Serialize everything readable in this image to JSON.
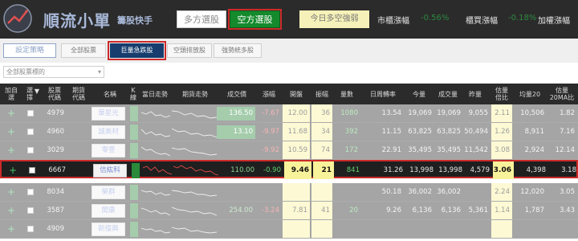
{
  "header": {
    "brand_name": "順流小單",
    "brand_sub": "籌股快手",
    "tabs": [
      "多方選股",
      "空方選股"
    ],
    "daily_strength": "今日多空強弱",
    "indices": [
      {
        "label": "市櫃漲幅",
        "value": "-0.56%"
      },
      {
        "label": "櫃買漲幅",
        "value": "-0.18%"
      },
      {
        "label": "加權漲幅",
        "value": ""
      }
    ],
    "accent_colors": {
      "selected_tab": "#148a2c",
      "highlight_border": "#cc2a2a",
      "selected_chip": "#163d6e",
      "price_cell": "#f8f29a"
    }
  },
  "filters": {
    "strategy": "設定策略",
    "chips": [
      "全部股票",
      "巨量急跌股",
      "空頭排放股",
      "強勢統多股"
    ],
    "selected_chip": "巨量急跌股",
    "select_value": "全部股票標的"
  },
  "table": {
    "columns": {
      "add": [
        "加自",
        "選"
      ],
      "sel": [
        "選",
        "擇"
      ],
      "code": [
        "股票",
        "代碼"
      ],
      "sub": [
        "期貨",
        "代碼"
      ],
      "name": [
        "名稱"
      ],
      "k": [
        "K",
        "線"
      ],
      "trend": [
        "當日走勢"
      ],
      "trend2": [
        "期貨走勢"
      ],
      "close": [
        "成交價"
      ],
      "change": [
        "漲幅"
      ],
      "open": [
        "開盤"
      ],
      "high": [
        "振幅"
      ],
      "vol": [
        "量數"
      ],
      "ratio": [
        "日周轉率"
      ],
      "today_vol": [
        "今量"
      ],
      "amount": [
        "成交量"
      ],
      "yest": [
        "昨量"
      ],
      "est": [
        "估量",
        "倍比"
      ],
      "avg20": [
        "均量20"
      ],
      "estavg": [
        "估量",
        "20MA比"
      ]
    },
    "sort_arrow": "▼",
    "rows": [
      {
        "add": "+",
        "code": "4979",
        "name": "華星光",
        "close": "136.50",
        "change": "-7.67",
        "open": "12.00",
        "high": "36",
        "vol": "1080",
        "ratio": "13.54",
        "today_vol": "19,069",
        "amount": "19,069",
        "yest": "9,055",
        "est": "2.11",
        "avg20": "10,506",
        "estavg": "1.82",
        "close_style": "green"
      },
      {
        "add": "+",
        "code": "4960",
        "name": "誠美材",
        "close": "13.10",
        "change": "-9.97",
        "open": "11.68",
        "high": "34",
        "vol": "392",
        "ratio": "11.15",
        "today_vol": "63,825",
        "amount": "63,825",
        "yest": "50,494",
        "est": "1.26",
        "avg20": "8,911",
        "estavg": "7.16",
        "close_style": "green"
      },
      {
        "add": "+",
        "code": "3029",
        "name": "零壹",
        "close": "",
        "change": "-9.92",
        "open": "10.59",
        "high": "74",
        "vol": "172",
        "ratio": "22.91",
        "today_vol": "35,495",
        "amount": "35,495",
        "yest": "11,542",
        "est": "3.08",
        "avg20": "2,924",
        "estavg": "12.14",
        "close_style": "none"
      },
      {
        "add": "+",
        "code": "6667",
        "name": "信紘科",
        "close": "110.00",
        "change": "-0.90",
        "open": "9.46",
        "high": "21",
        "vol": "841",
        "ratio": "31.26",
        "today_vol": "13,998",
        "amount": "13,998",
        "yest": "4,579",
        "est": "3.06",
        "avg20": "4,398",
        "estavg": "3.18",
        "close_style": "plain"
      },
      {
        "add": "+",
        "code": "8034",
        "name": "榮群",
        "close": "",
        "change": "",
        "open": "",
        "high": "",
        "vol": "",
        "ratio": "50.18",
        "today_vol": "36,002",
        "amount": "36,002",
        "yest": "",
        "est": "2.24",
        "avg20": "12,020",
        "estavg": "3.05",
        "close_style": "none"
      },
      {
        "add": "+",
        "code": "3587",
        "name": "閎康",
        "close": "254.00",
        "change": "-3.24",
        "open": "7.81",
        "high": "41",
        "vol": "20",
        "ratio": "9.26",
        "today_vol": "6,136",
        "amount": "6,136",
        "yest": "5,361",
        "est": "1.14",
        "avg20": "1,787",
        "estavg": "3.43",
        "close_style": "none"
      },
      {
        "add": "+",
        "code": "4909",
        "name": "新復興",
        "close": "",
        "change": "",
        "open": "",
        "high": "",
        "vol": "",
        "ratio": "",
        "today_vol": "",
        "amount": "",
        "yest": "",
        "est": "",
        "avg20": "",
        "estavg": "",
        "close_style": "none"
      }
    ]
  }
}
